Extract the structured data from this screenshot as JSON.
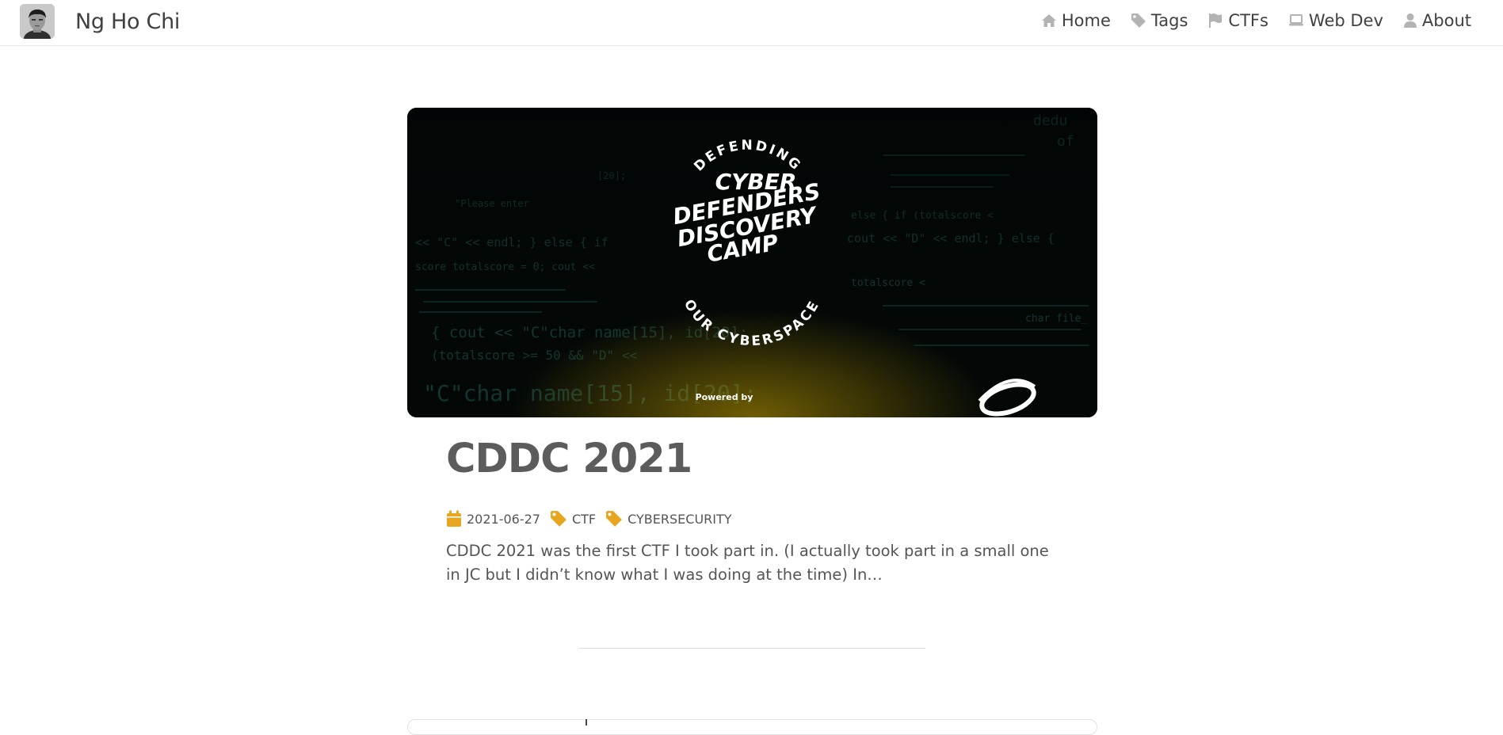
{
  "brand": {
    "name": "Ng Ho Chi"
  },
  "nav": {
    "items": [
      {
        "label": "Home",
        "icon": "home-icon"
      },
      {
        "label": "Tags",
        "icon": "tag-icon"
      },
      {
        "label": "CTFs",
        "icon": "flag-icon"
      },
      {
        "label": "Web Dev",
        "icon": "laptop-icon"
      },
      {
        "label": "About",
        "icon": "user-icon"
      }
    ]
  },
  "post": {
    "hero": {
      "logo_top": "DEFENDING",
      "logo_lines": [
        "CYBER",
        "DEFENDERS",
        "DISCOVERY",
        "CAMP"
      ],
      "logo_bottom": "OUR CYBERSPACE",
      "powered_by": "Powered by"
    },
    "title": "CDDC 2021",
    "date": "2021-06-27",
    "tags": [
      "CTF",
      "CYBERSECURITY"
    ],
    "excerpt": "CDDC 2021 was the first CTF I took part in. (I actually took part in a small one in JC but I didn’t know what I was doing at the time) In…"
  },
  "colors": {
    "accent": "#e8a520",
    "text": "#404040",
    "muted_icon": "#b3b3b3",
    "code_green": "#2f7e6f"
  }
}
